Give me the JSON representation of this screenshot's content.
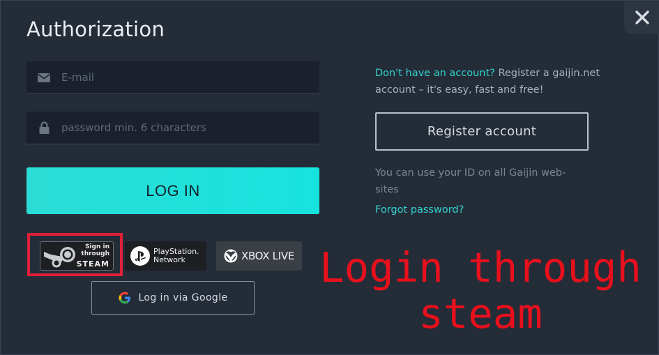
{
  "dialog": {
    "title": "Authorization",
    "close_icon": "close-icon"
  },
  "login_form": {
    "email_placeholder": "E-mail",
    "email_value": "",
    "password_placeholder": "password min. 6 characters",
    "password_value": "",
    "login_label": "LOG IN"
  },
  "social": {
    "steam": {
      "line1": "Sign in",
      "line2": "through",
      "line3": "STEAM"
    },
    "playstation": {
      "line1": "PlayStation.",
      "line2": "Network"
    },
    "xbox": {
      "label": "XBOX LIVE"
    },
    "google": {
      "label": "Log in via Google"
    }
  },
  "register": {
    "question_link": "Don't have an account?",
    "description": " Register a gaijin.net account – it's easy, fast and free!",
    "button_label": "Register account",
    "id_note": "You can use your ID on all Gaijin web-sites",
    "forgot_link": "Forgot password?"
  },
  "annotation": {
    "line1": "Login through",
    "line2": "steam",
    "color": "#e8101c"
  },
  "colors": {
    "background": "#242c38",
    "accent": "#2bdcd6",
    "link": "#33d2cf",
    "highlight": "#e0203a"
  }
}
